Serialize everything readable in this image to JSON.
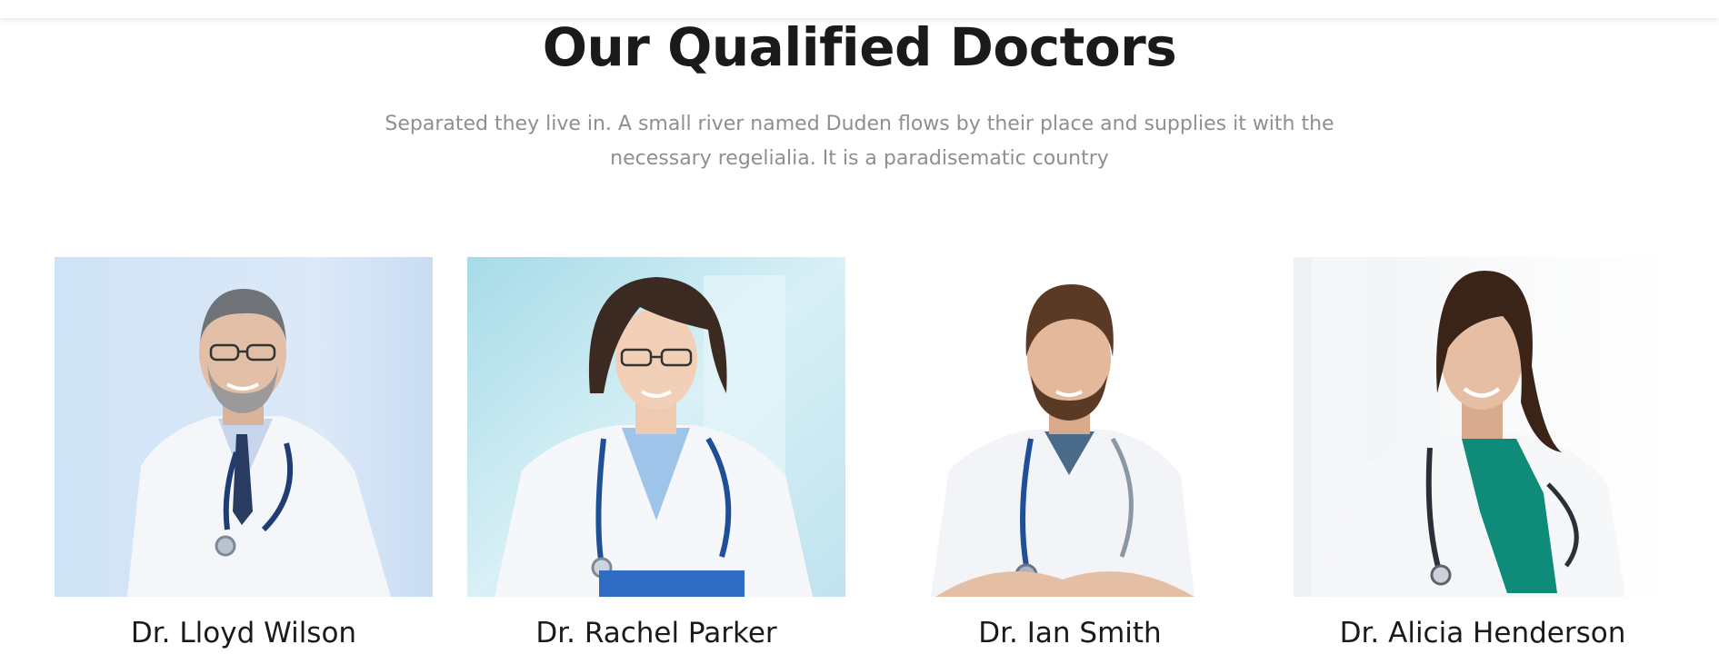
{
  "section": {
    "title": "Our Qualified Doctors",
    "description": "Separated they live in. A small river named Duden flows by their place and supplies it with the necessary regelialia. It is a paradisematic country"
  },
  "doctors": [
    {
      "name": "Dr. Lloyd Wilson"
    },
    {
      "name": "Dr. Rachel Parker"
    },
    {
      "name": "Dr. Ian Smith"
    },
    {
      "name": "Dr. Alicia Henderson"
    }
  ],
  "colors": {
    "heading": "#1a1a1a",
    "body_text": "#8f8f8f",
    "coat": "#f4f6fa",
    "stethoscope": "#1f4f99"
  }
}
